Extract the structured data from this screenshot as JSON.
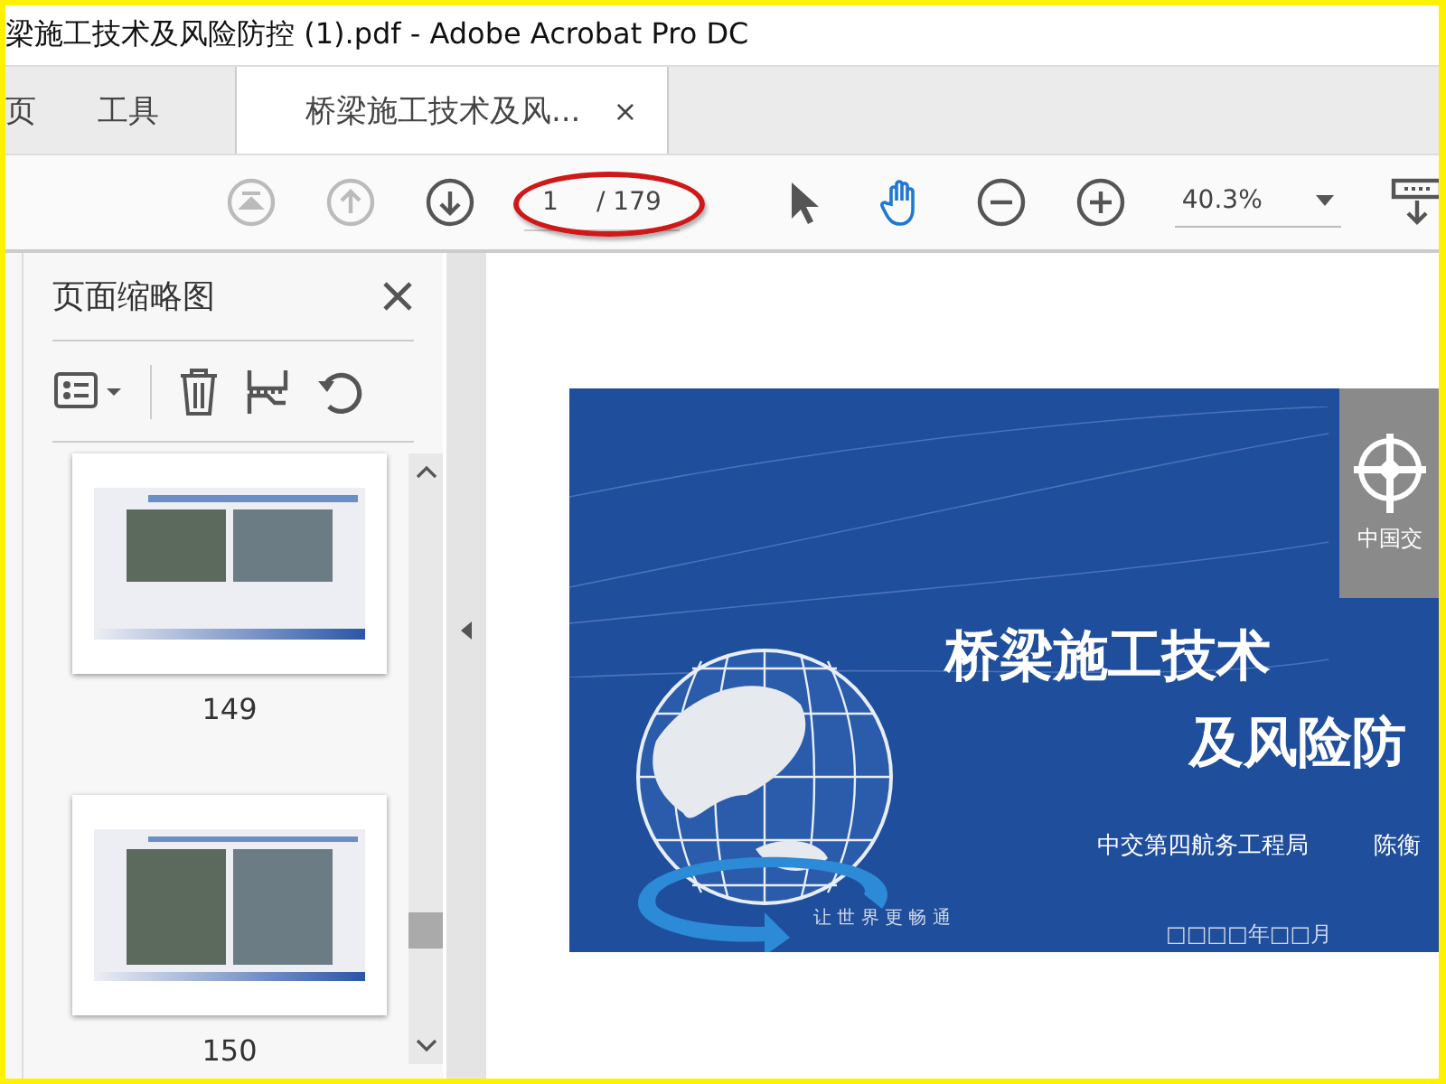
{
  "window": {
    "title": "梁施工技术及风险防控 (1).pdf - Adobe Acrobat Pro DC"
  },
  "tabs": [
    {
      "label": "页",
      "selected": false
    },
    {
      "label": "工具",
      "selected": false
    },
    {
      "label": "桥梁施工技术及风...",
      "selected": true,
      "close": "×"
    }
  ],
  "toolbar": {
    "nav": [
      {
        "kind": "first",
        "disabled": true
      },
      {
        "kind": "prev",
        "disabled": true
      },
      {
        "kind": "next",
        "disabled": false
      }
    ],
    "page": {
      "value": "1",
      "total": "/ 179",
      "highlighted": true
    },
    "tools": [
      {
        "kind": "pointer",
        "selected": false
      },
      {
        "kind": "hand",
        "selected": true
      }
    ],
    "zoom": {
      "value": "40.3%"
    }
  },
  "sidebar": {
    "title": "页面缩略图",
    "thumbnails": [
      {
        "label": "149",
        "kind": "collapse"
      },
      {
        "label": "150",
        "kind": "boats"
      }
    ]
  },
  "document": {
    "slide": {
      "logo_text": "中国交",
      "title_lines": [
        "桥梁施工技术",
        "及风险防"
      ],
      "organization": "中交第四航务工程局",
      "author": "陈衡",
      "slogan": "让 世 界 更 畅 通",
      "date": "□□□□年□□月"
    }
  }
}
